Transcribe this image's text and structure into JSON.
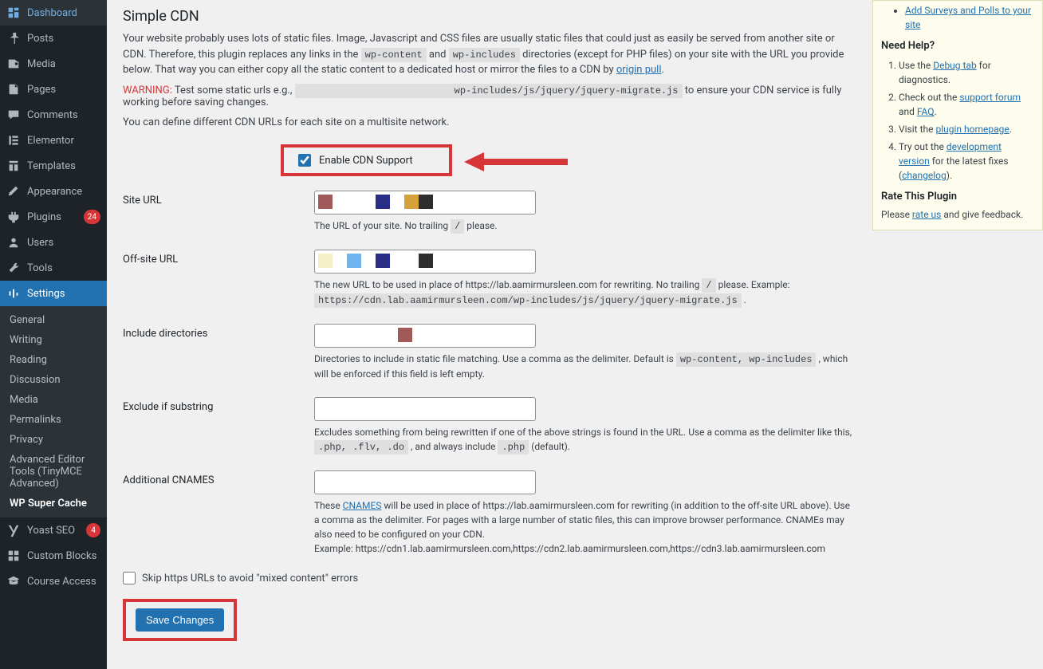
{
  "sidebar": {
    "menu": [
      {
        "icon": "dashboard",
        "label": "Dashboard"
      },
      {
        "icon": "pin",
        "label": "Posts"
      },
      {
        "icon": "media",
        "label": "Media"
      },
      {
        "icon": "pages",
        "label": "Pages"
      },
      {
        "icon": "comments",
        "label": "Comments"
      },
      {
        "icon": "elementor",
        "label": "Elementor"
      },
      {
        "icon": "templates",
        "label": "Templates"
      },
      {
        "icon": "appearance",
        "label": "Appearance"
      },
      {
        "icon": "plugins",
        "label": "Plugins",
        "badge": "24"
      },
      {
        "icon": "users",
        "label": "Users"
      },
      {
        "icon": "tools",
        "label": "Tools"
      },
      {
        "icon": "settings",
        "label": "Settings",
        "active": true
      }
    ],
    "submenu": [
      {
        "label": "General"
      },
      {
        "label": "Writing"
      },
      {
        "label": "Reading"
      },
      {
        "label": "Discussion"
      },
      {
        "label": "Media"
      },
      {
        "label": "Permalinks"
      },
      {
        "label": "Privacy"
      },
      {
        "label": "Advanced Editor Tools (TinyMCE Advanced)"
      },
      {
        "label": "WP Super Cache",
        "highlight": true
      }
    ],
    "bottom": [
      {
        "icon": "yoast",
        "label": "Yoast SEO",
        "badge": "4"
      },
      {
        "icon": "blocks",
        "label": "Custom Blocks"
      },
      {
        "icon": "course",
        "label": "Course Access"
      }
    ]
  },
  "page": {
    "title": "Simple CDN",
    "intro_1": "Your website probably uses lots of static files. Image, Javascript and CSS files are usually static files that could just as easily be served from another site or CDN. Therefore, this plugin replaces any links in the ",
    "intro_code1": "wp-content",
    "intro_and": " and ",
    "intro_code2": "wp-includes",
    "intro_2": " directories (except for PHP files) on your site with the URL you provide below. That way you can either copy all the static content to a dedicated host or mirror the files to a CDN by ",
    "intro_link": "origin pull",
    "warning_label": "WARNING:",
    "warning_text_1": " Test some static urls e.g., ",
    "warning_code": "wp-includes/js/jquery/jquery-migrate.js",
    "warning_text_2": " to ensure your CDN service is fully working before saving changes.",
    "multisite_note": "You can define different CDN URLs for each site on a multisite network.",
    "enable_label": "Enable CDN Support",
    "fields": {
      "site_url": {
        "label": "Site URL",
        "desc_1": "The URL of your site. No trailing ",
        "desc_code": "/",
        "desc_2": " please."
      },
      "offsite_url": {
        "label": "Off-site URL",
        "desc_1": "The new URL to be used in place of https://lab.aamirmursleen.com for rewriting. No trailing ",
        "desc_code": "/",
        "desc_2": " please. Example: ",
        "desc_example": "https://cdn.lab.aamirmursleen.com/wp-includes/js/jquery/jquery-migrate.js",
        "desc_3": " ."
      },
      "include_dirs": {
        "label": "Include directories",
        "desc_1": "Directories to include in static file matching. Use a comma as the delimiter. Default is ",
        "desc_code": "wp-content, wp-includes",
        "desc_2": " , which will be enforced if this field is left empty."
      },
      "exclude": {
        "label": "Exclude if substring",
        "desc_1": "Excludes something from being rewritten if one of the above strings is found in the URL. Use a comma as the delimiter like this, ",
        "desc_code1": ".php, .flv, .do",
        "desc_2": " , and always include ",
        "desc_code2": ".php",
        "desc_3": " (default)."
      },
      "cnames": {
        "label": "Additional CNAMES",
        "desc_1": "These ",
        "desc_link": "CNAMES",
        "desc_2": " will be used in place of https://lab.aamirmursleen.com for rewriting (in addition to the off-site URL above). Use a comma as the delimiter. For pages with a large number of static files, this can improve browser performance. CNAMEs may also need to be configured on your CDN.",
        "desc_example": "Example: https://cdn1.lab.aamirmursleen.com,https://cdn2.lab.aamirmursleen.com,https://cdn3.lab.aamirmursleen.com"
      }
    },
    "skip_https": "Skip https URLs to avoid \"mixed content\" errors",
    "save_button": "Save Changes"
  },
  "right": {
    "top_link": "Add Surveys and Polls to your site",
    "need_help": "Need Help?",
    "help_items": [
      {
        "pre": "Use the ",
        "link": "Debug tab",
        "post": " for diagnostics."
      },
      {
        "pre": "Check out the ",
        "link": "support forum",
        "mid": " and ",
        "link2": "FAQ",
        "post": "."
      },
      {
        "pre": "Visit the ",
        "link": "plugin homepage",
        "post": "."
      },
      {
        "pre": "Try out the ",
        "link": "development version",
        "post": " for the latest fixes (",
        "link2": "changelog",
        "post2": ")."
      }
    ],
    "rate_title": "Rate This Plugin",
    "rate_text_1": "Please ",
    "rate_link": "rate us",
    "rate_text_2": " and give feedback."
  }
}
